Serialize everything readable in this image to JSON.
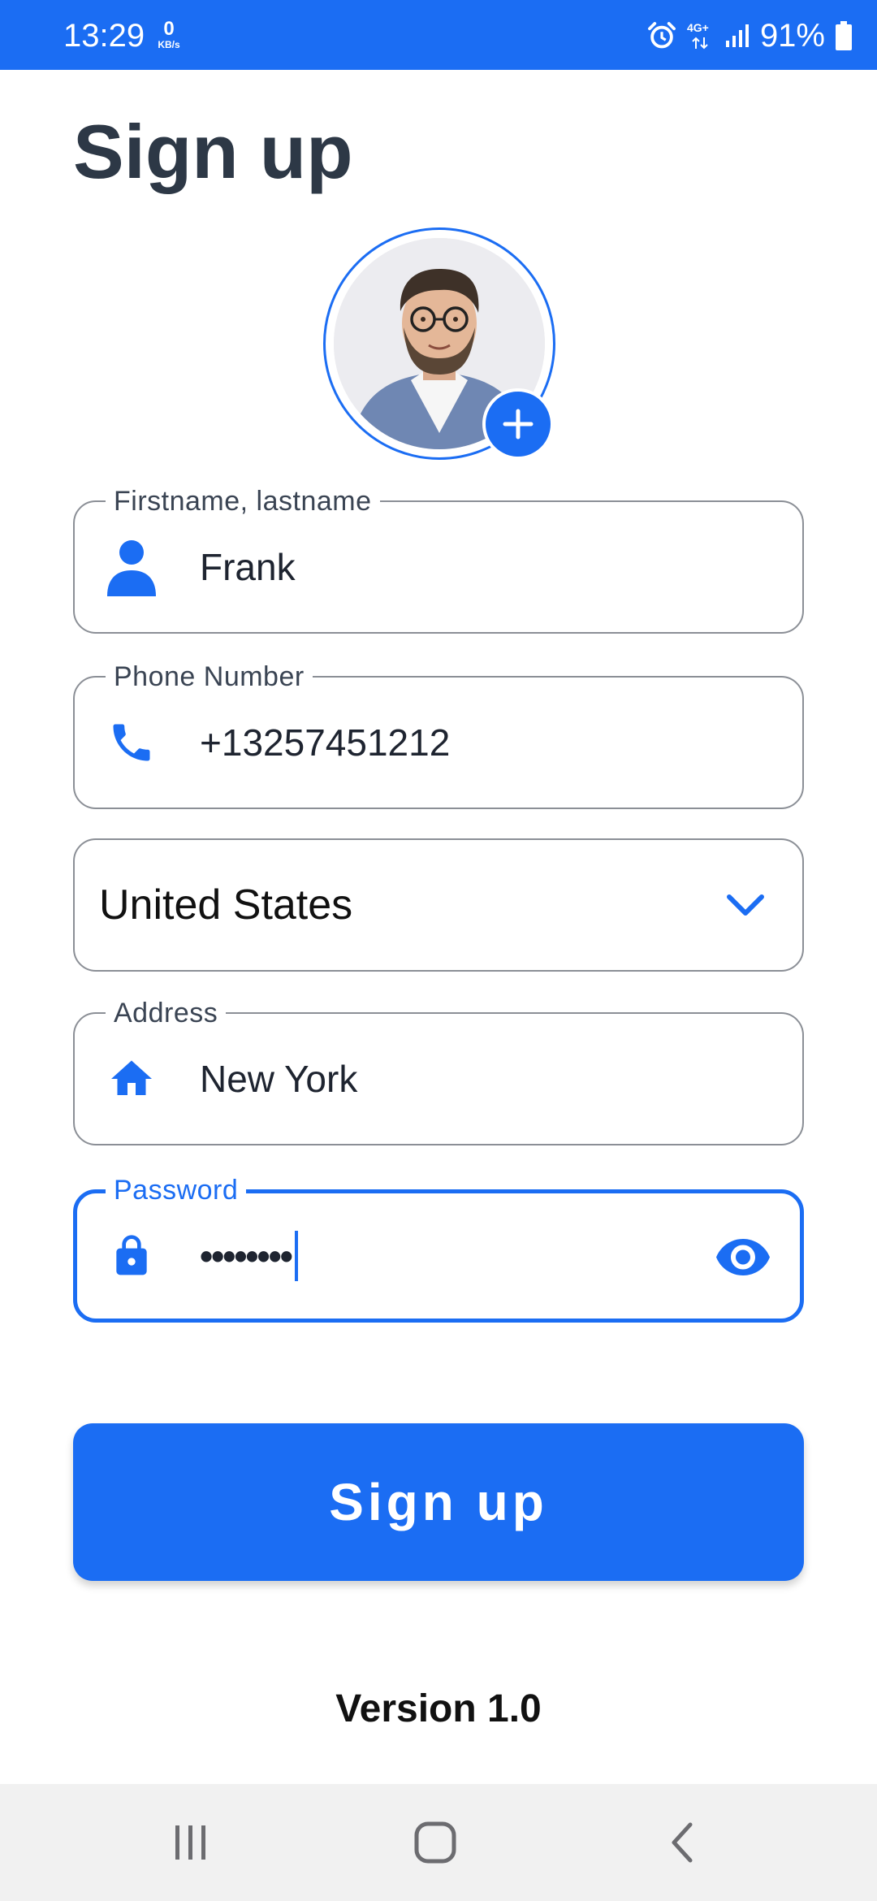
{
  "status_bar": {
    "time": "13:29",
    "net_speed_value": "0",
    "net_speed_unit": "KB/s",
    "network_type": "4G+",
    "battery_percent": "91%",
    "icons": [
      "alarm-icon",
      "network-4g-icon",
      "signal-icon",
      "battery-icon"
    ]
  },
  "page": {
    "title": "Sign up"
  },
  "avatar": {
    "icons": [
      "profile-photo",
      "add-photo-icon"
    ]
  },
  "form": {
    "name": {
      "label": "Firstname, lastname",
      "value": "Frank",
      "icon": "person-icon"
    },
    "phone": {
      "label": "Phone Number",
      "value": "+13257451212",
      "icon": "phone-icon"
    },
    "country": {
      "selected": "United States",
      "icon": "chevron-down-icon"
    },
    "address": {
      "label": "Address",
      "value": "New York",
      "icon": "home-icon"
    },
    "password": {
      "label": "Password",
      "value_masked": "••••••••",
      "icon": "lock-icon",
      "toggle_icon": "eye-icon",
      "focused": true
    }
  },
  "signup_button": {
    "label": "Sign up"
  },
  "footer": {
    "version": "Version 1.0"
  },
  "nav_bar": {
    "icons": [
      "recent-apps-icon",
      "home-button-icon",
      "back-icon"
    ]
  },
  "colors": {
    "accent": "#1b6df3",
    "title_text": "#2d3846",
    "field_border": "#8b8f96",
    "nav_bar_bg": "#f1f1f1"
  }
}
